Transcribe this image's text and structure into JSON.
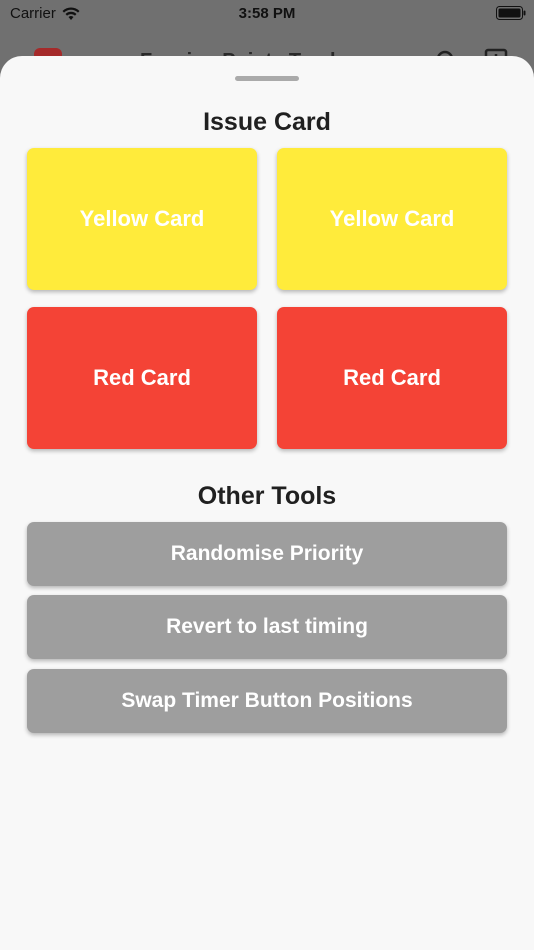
{
  "status_bar": {
    "carrier": "Carrier",
    "time": "3:58 PM"
  },
  "background_app": {
    "title": "Fencing Points Tracker"
  },
  "sheet": {
    "issue_card_title": "Issue Card",
    "cards": [
      {
        "label": "Yellow Card",
        "color": "#ffeb3b"
      },
      {
        "label": "Yellow Card",
        "color": "#ffeb3b"
      },
      {
        "label": "Red Card",
        "color": "#f44336"
      },
      {
        "label": "Red Card",
        "color": "#f44336"
      }
    ],
    "other_tools_title": "Other Tools",
    "tools": [
      {
        "label": "Randomise Priority"
      },
      {
        "label": "Revert to last timing"
      },
      {
        "label": "Swap Timer Button Positions"
      }
    ],
    "button_color": "#9e9e9e"
  }
}
